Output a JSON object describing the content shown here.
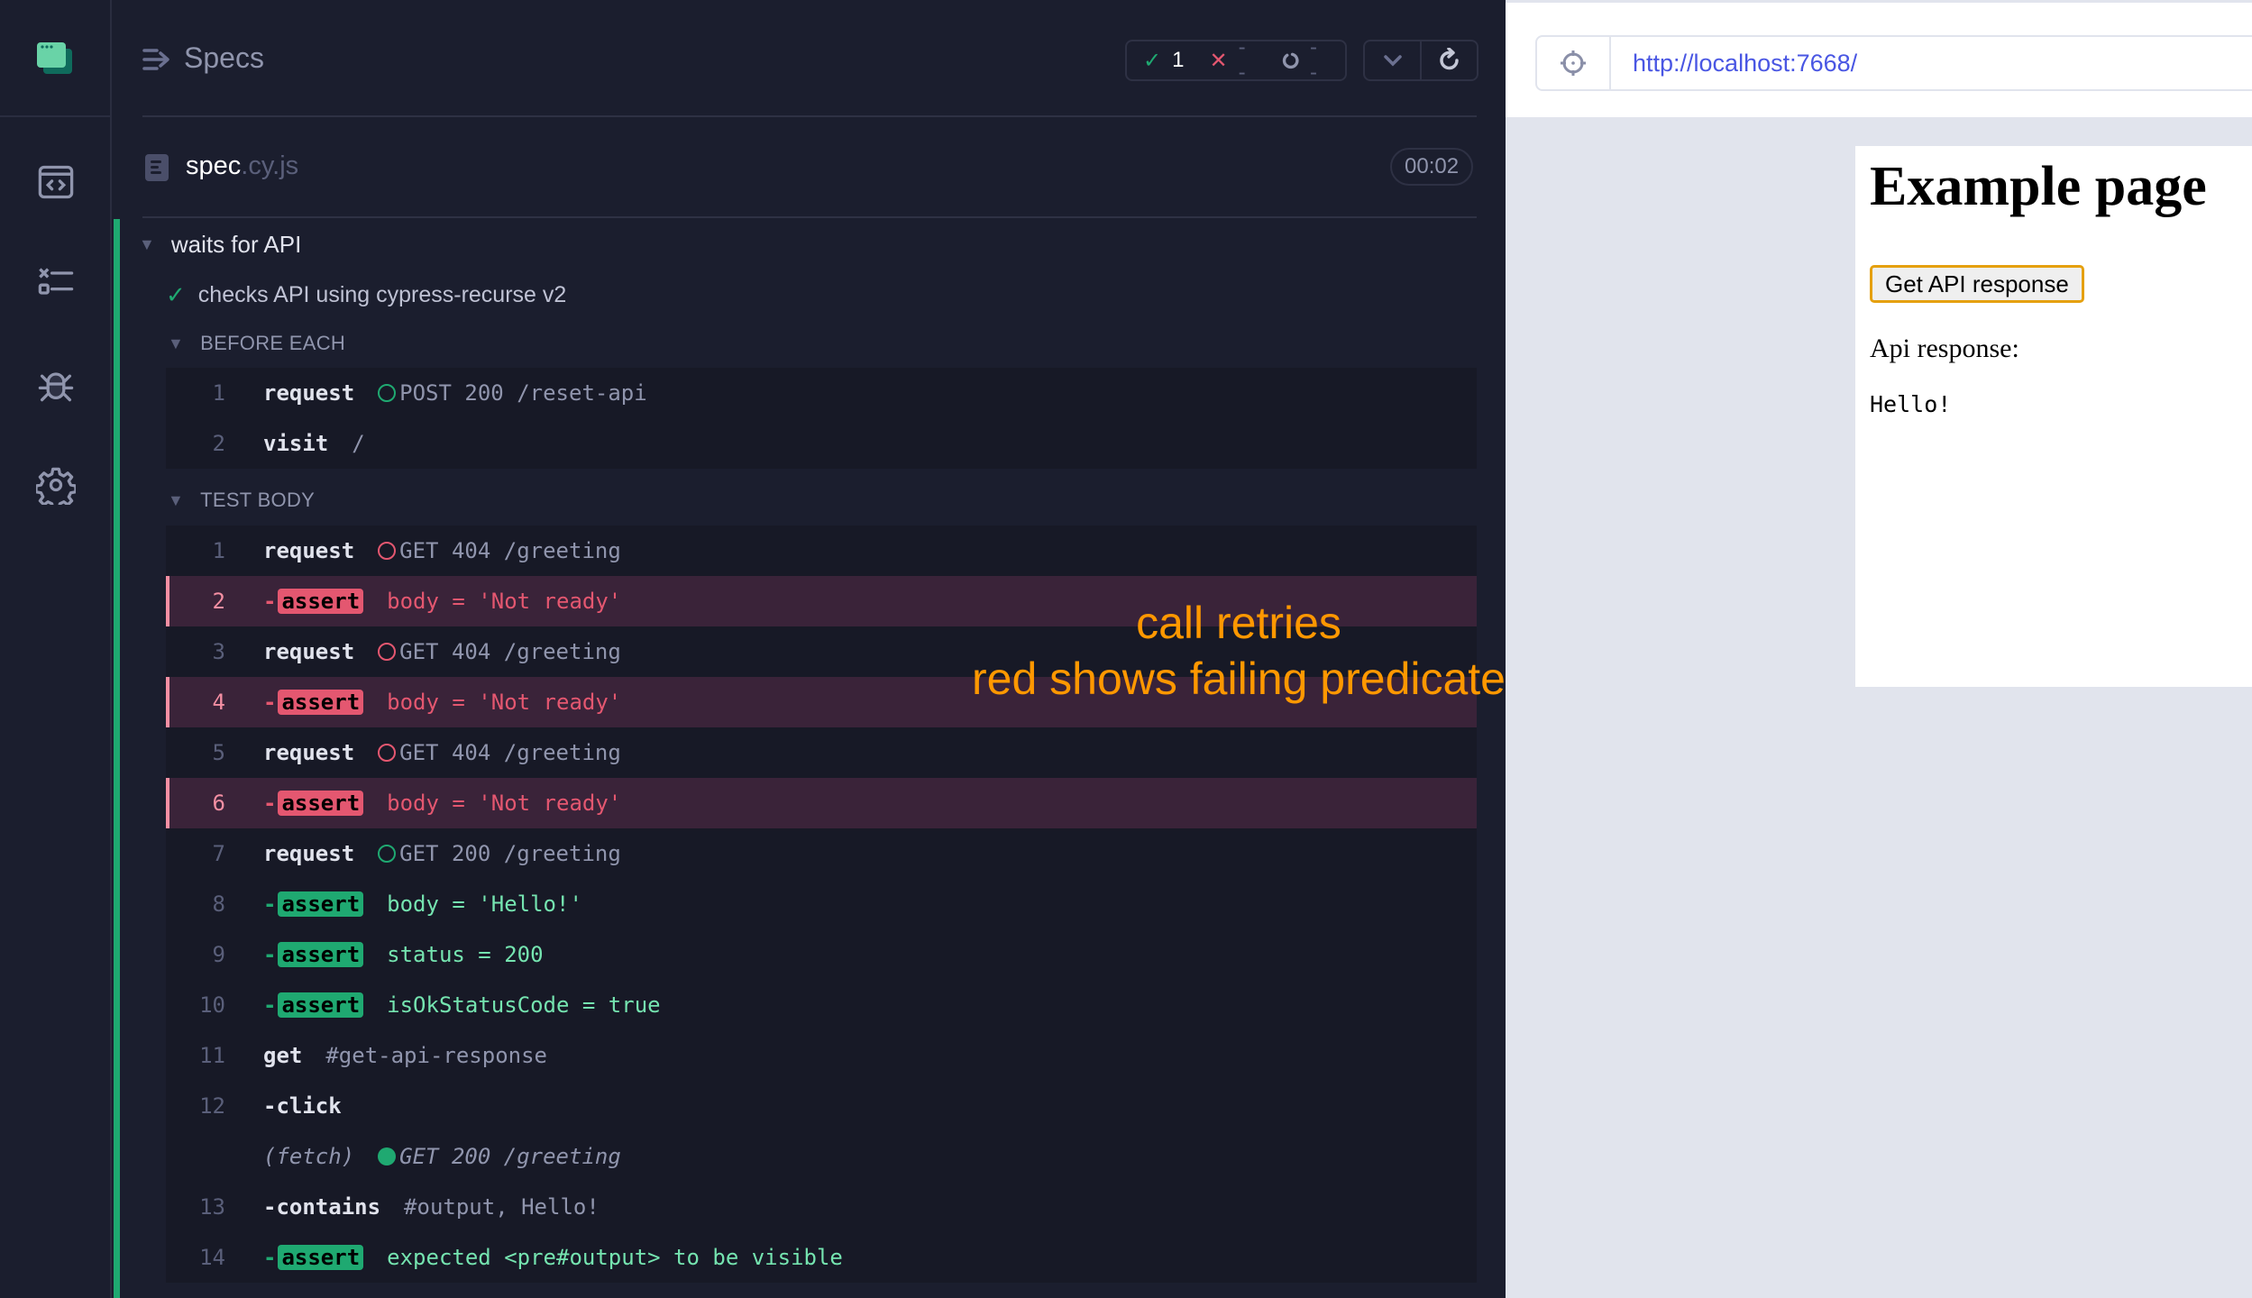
{
  "sidebar": {
    "items": [
      {
        "icon": "specs-browser-icon",
        "label": "Specs"
      },
      {
        "icon": "runs-icon",
        "label": "Runs"
      },
      {
        "icon": "debug-icon",
        "label": "Debug"
      },
      {
        "icon": "settings-icon",
        "label": "Settings"
      }
    ]
  },
  "header": {
    "title": "Specs",
    "stats": {
      "passed": "1",
      "failed": "--",
      "pending": "--"
    }
  },
  "spec": {
    "name": "spec",
    "ext": ".cy.js",
    "duration": "00:02"
  },
  "suite": {
    "title": "waits for API"
  },
  "test": {
    "title": "checks API using cypress-recurse v2",
    "state": "passed"
  },
  "hooks": {
    "before_each": {
      "title": "BEFORE EACH",
      "commands": [
        {
          "num": "1",
          "name": "request",
          "indicator": "green",
          "message": "POST 200 /reset-api"
        },
        {
          "num": "2",
          "name": "visit",
          "message": "/"
        }
      ]
    },
    "test_body": {
      "title": "TEST BODY",
      "commands": [
        {
          "num": "1",
          "name": "request",
          "indicator": "red",
          "message": "GET 404 /greeting"
        },
        {
          "num": "2",
          "name": "assert",
          "child": true,
          "state": "failed",
          "message": "body = 'Not ready'"
        },
        {
          "num": "3",
          "name": "request",
          "indicator": "red",
          "message": "GET 404 /greeting"
        },
        {
          "num": "4",
          "name": "assert",
          "child": true,
          "state": "failed",
          "message": "body = 'Not ready'"
        },
        {
          "num": "5",
          "name": "request",
          "indicator": "red",
          "message": "GET 404 /greeting"
        },
        {
          "num": "6",
          "name": "assert",
          "child": true,
          "state": "failed",
          "message": "body = 'Not ready'"
        },
        {
          "num": "7",
          "name": "request",
          "indicator": "green",
          "message": "GET 200 /greeting"
        },
        {
          "num": "8",
          "name": "assert",
          "child": true,
          "state": "passed",
          "message": "body = 'Hello!'"
        },
        {
          "num": "9",
          "name": "assert",
          "child": true,
          "state": "passed",
          "message": "status = 200"
        },
        {
          "num": "10",
          "name": "assert",
          "child": true,
          "state": "passed",
          "message": "isOkStatusCode = true"
        },
        {
          "num": "11",
          "name": "get",
          "message": "#get-api-response"
        },
        {
          "num": "12",
          "name": "click",
          "child": true,
          "message": ""
        },
        {
          "num": "",
          "name": "(fetch)",
          "event": true,
          "indicator": "solid-green",
          "message": "GET 200 /greeting"
        },
        {
          "num": "13",
          "name": "contains",
          "child": true,
          "message": "#output, Hello!"
        },
        {
          "num": "14",
          "name": "assert",
          "child": true,
          "state": "passed",
          "message": "expected <pre#output> to be visible"
        }
      ]
    }
  },
  "annotation": {
    "line1": "call retries",
    "line2": "red shows failing predicate",
    "color": "#ff9800"
  },
  "aut": {
    "url": "http://localhost:7668/",
    "page": {
      "heading": "Example page",
      "button_label": "Get API response",
      "label": "Api response:",
      "output": "Hello!"
    }
  },
  "colors": {
    "pass": "#1fa971",
    "fail": "#e45770",
    "background": "#1b1e2e",
    "url": "#4956e3"
  }
}
